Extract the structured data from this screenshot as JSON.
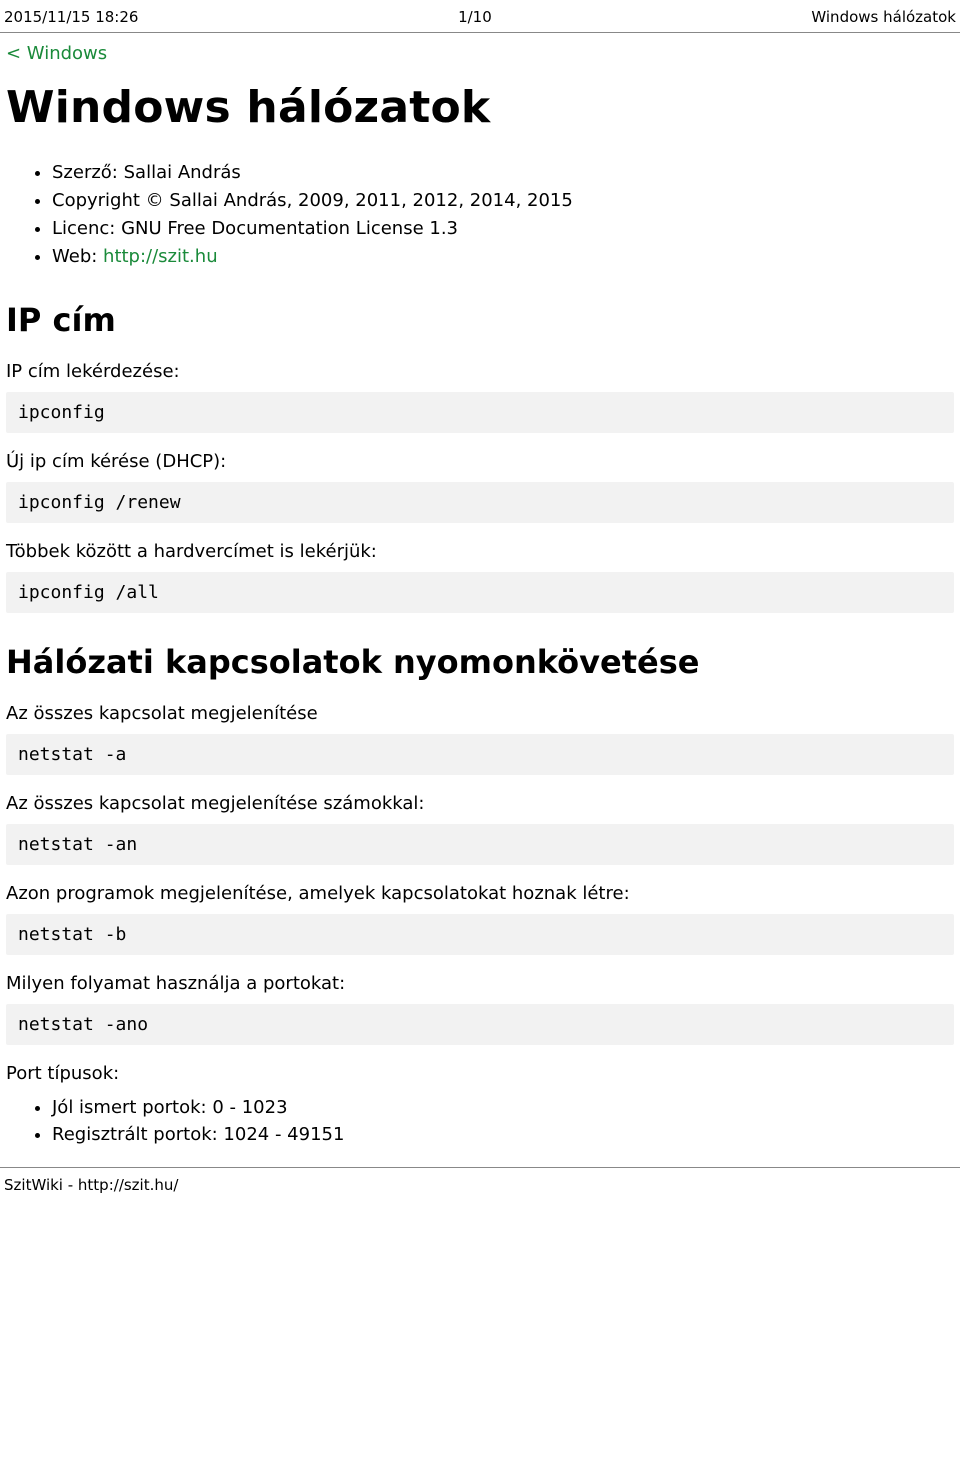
{
  "header": {
    "left": "2015/11/15 18:26",
    "center": "1/10",
    "right": "Windows hálózatok"
  },
  "nav": {
    "back_link": "< Windows"
  },
  "title": "Windows hálózatok",
  "meta": {
    "author_label": "Szerző:",
    "author_name": "Sallai András",
    "copyright": "Copyright © Sallai András, 2009, 2011, 2012, 2014, 2015",
    "license": "Licenc: GNU Free Documentation License 1.3",
    "web_label": "Web: ",
    "web_url": "http://szit.hu"
  },
  "sections": {
    "ip": {
      "heading": "IP cím",
      "p1": "IP cím lekérdezése:",
      "c1": "ipconfig",
      "p2": "Új ip cím kérése (DHCP):",
      "c2": "ipconfig /renew",
      "p3": "Többek között a hardvercímet is lekérjük:",
      "c3": "ipconfig /all"
    },
    "net": {
      "heading": "Hálózati kapcsolatok nyomonkövetése",
      "p1": "Az összes kapcsolat megjelenítése",
      "c1": "netstat -a",
      "p2": "Az összes kapcsolat megjelenítése számokkal:",
      "c2": "netstat -an",
      "p3": "Azon programok megjelenítése, amelyek kapcsolatokat hoznak létre:",
      "c3": "netstat -b",
      "p4": "Milyen folyamat használja a portokat:",
      "c4": "netstat -ano",
      "p5": "Port típusok:",
      "li1": "Jól ismert portok: 0 - 1023",
      "li2": "Regisztrált portok: 1024 - 49151"
    }
  },
  "footer": "SzitWiki - http://szit.hu/"
}
